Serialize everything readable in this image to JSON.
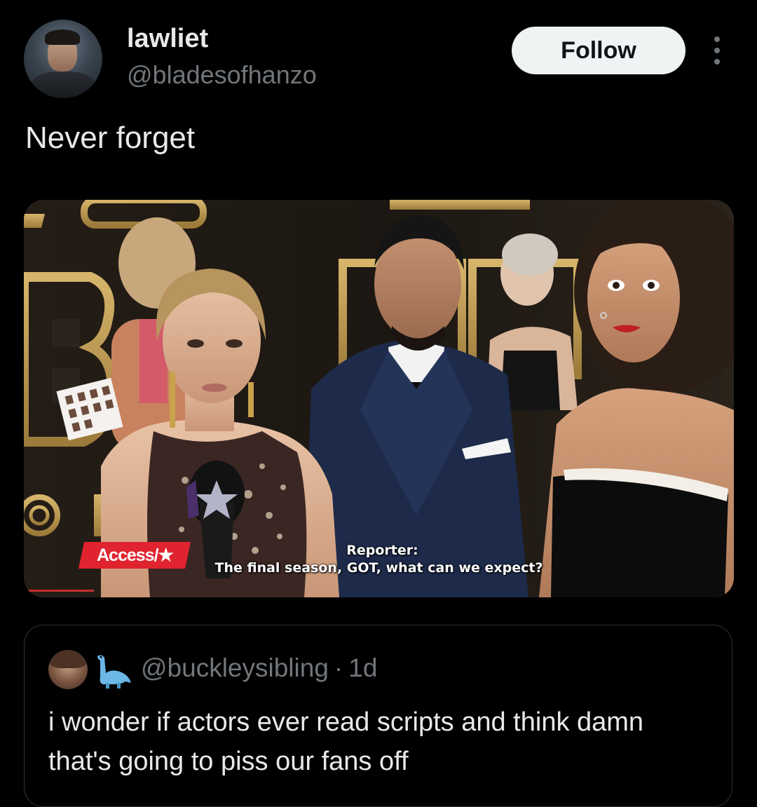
{
  "tweet": {
    "display_name": "lawliet",
    "handle": "@bladesofhanzo",
    "follow_label": "Follow",
    "text": "Never forget",
    "avatar_icon": "avatar-icon",
    "more_icon": "more-options-icon"
  },
  "media": {
    "logo_label": "Access/★",
    "caption_line1": "Reporter:",
    "caption_line2": "The final season, GOT, what can we expect?"
  },
  "quote": {
    "handle": "@buckleysibling",
    "separator": "·",
    "time": "1d",
    "text": "i wonder if actors ever read scripts and think damn that's going to piss our fans off",
    "emoji_icon": "dinosaur-icon"
  },
  "colors": {
    "background": "#000000",
    "primary_text": "#e7e9ea",
    "secondary_text": "#71767b",
    "follow_button_bg": "#eff3f4",
    "quote_border": "#2f3336",
    "access_red": "#e0242f"
  }
}
